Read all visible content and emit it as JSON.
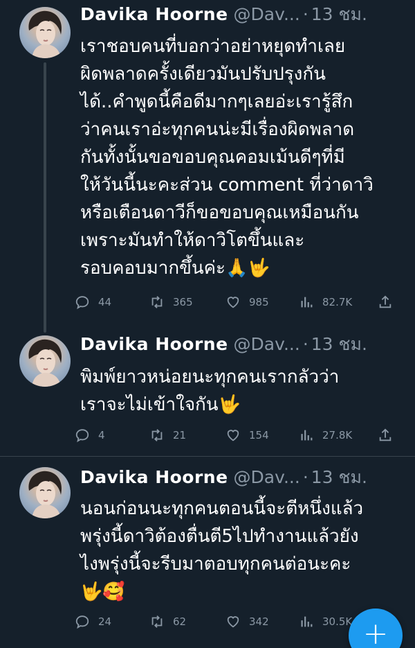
{
  "tweets": [
    {
      "name": "Davika Hoorne",
      "handle": "@Dav...",
      "separator": "·",
      "time": "13 ชม.",
      "lines": [
        "เราชอบคนที่บอกว่าอย่าหยุดทำเลย",
        "ผิดพลาดครั้งเดียวมันปรับปรุงกัน",
        "ได้..คำพูดนี้คือดีมากๆเลยอ่ะเรารู้สึก",
        "ว่าคนเราอ่ะทุกคนน่ะมีเรื่องผิดพลาด",
        "กันทั้งนั้นขอขอบคุณคอมเม้นดีๆที่มี",
        "ให้วันนี้นะคะส่วน comment ที่ว่าดาวิ",
        "หรือเตือนดาวีก็ขอขอบคุณเหมือนกัน",
        "เพราะมันทำให้ดาวิโตขึ้นและ",
        "รอบคอบมากขึ้นค่ะ🙏🤟"
      ],
      "replies": "44",
      "retweets": "365",
      "likes": "985",
      "views": "82.7K"
    },
    {
      "name": "Davika Hoorne",
      "handle": "@Dav...",
      "separator": "·",
      "time": "13 ชม.",
      "lines": [
        "พิมพ์ยาวหน่อยนะทุกคนเรากลัวว่า",
        "เราจะไม่เข้าใจกัน🤟"
      ],
      "replies": "4",
      "retweets": "21",
      "likes": "154",
      "views": "27.8K"
    },
    {
      "name": "Davika Hoorne",
      "handle": "@Dav...",
      "separator": "·",
      "time": "13 ชม.",
      "lines": [
        "นอนก่อนนะทุกคนตอนนี้จะตีหนึ่งแล้ว",
        "พรุ่งนี้ดาวิต้องตื่นตี5ไปทำงานแล้วยัง",
        "ไงพรุ่งนี้จะรีบมาตอบทุกคนต่อนะคะ",
        "🤟🥰"
      ],
      "replies": "24",
      "retweets": "62",
      "likes": "342",
      "views": "30.5K"
    }
  ],
  "fab": {
    "icon": "plus-icon",
    "label": "+"
  },
  "colors": {
    "background": "#15202b",
    "text": "#ffffff",
    "secondary": "#8b98a5",
    "divider": "#38444d",
    "accent": "#1d9bf0"
  }
}
